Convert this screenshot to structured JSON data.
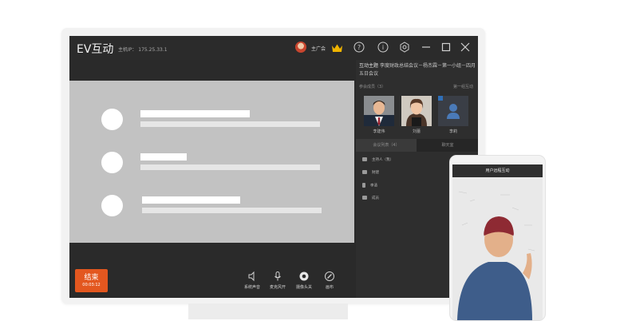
{
  "app": {
    "title": "EV互动",
    "sub_info": "主机IP：  175.25.33.1",
    "user_name": "主广会"
  },
  "window_icons": [
    "help-icon",
    "info-icon",
    "settings-icon",
    "minimize-icon",
    "maximize-icon",
    "close-icon"
  ],
  "end_button": {
    "label": "结束",
    "time": "00:03:12"
  },
  "controls": [
    {
      "label": "系统声音",
      "icon": "speaker-icon"
    },
    {
      "label": "麦克风开",
      "icon": "microphone-icon"
    },
    {
      "label": "摄像头关",
      "icon": "camera-icon"
    },
    {
      "label": "画布",
      "icon": "canvas-icon"
    }
  ],
  "panel": {
    "topic_key": "互动主题",
    "topic_text": "李度财政总结会议－杨杰霖－第一小组－四月五日会议",
    "members_label": "参会成员（3）",
    "all_mute": "第一组互动",
    "members": [
      {
        "name": "李建伟"
      },
      {
        "name": "刘蕾"
      },
      {
        "name": "李莉"
      }
    ],
    "tabs": [
      {
        "label": "会议列表（4）",
        "active": true
      },
      {
        "label": "聊天室",
        "active": false
      }
    ],
    "cameras": [
      "主持人（我）",
      "财建",
      "李清",
      "成员"
    ]
  },
  "phone": {
    "title": "用户远程互动"
  },
  "colors": {
    "accent": "#e3571f",
    "screen_bg": "#2a2a2a",
    "stage_bg": "#c2c2c2",
    "crown": "#f0b400"
  }
}
